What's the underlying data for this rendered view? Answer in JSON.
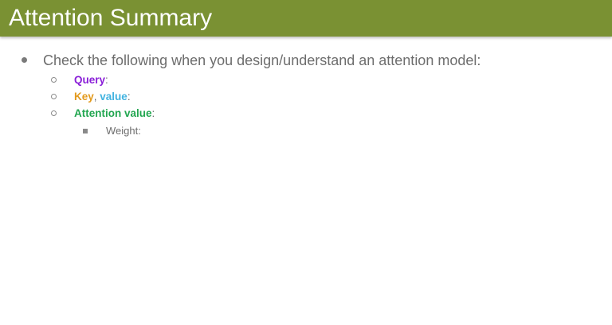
{
  "slide": {
    "title": "Attention Summary",
    "bullet": "Check the following when you design/understand an attention model:",
    "items": [
      {
        "term": "Query",
        "suffix": ":"
      },
      {
        "term": "Key",
        "sep": ", ",
        "term2": "value",
        "suffix": ":"
      },
      {
        "term": "Attention value",
        "suffix": ":"
      }
    ],
    "subitem": "Weight:"
  },
  "colors": {
    "title_bar": "#7a9133",
    "query": "#8a1fd8",
    "key": "#e39a1d",
    "value": "#42b3e0",
    "attention_value": "#22a650"
  }
}
